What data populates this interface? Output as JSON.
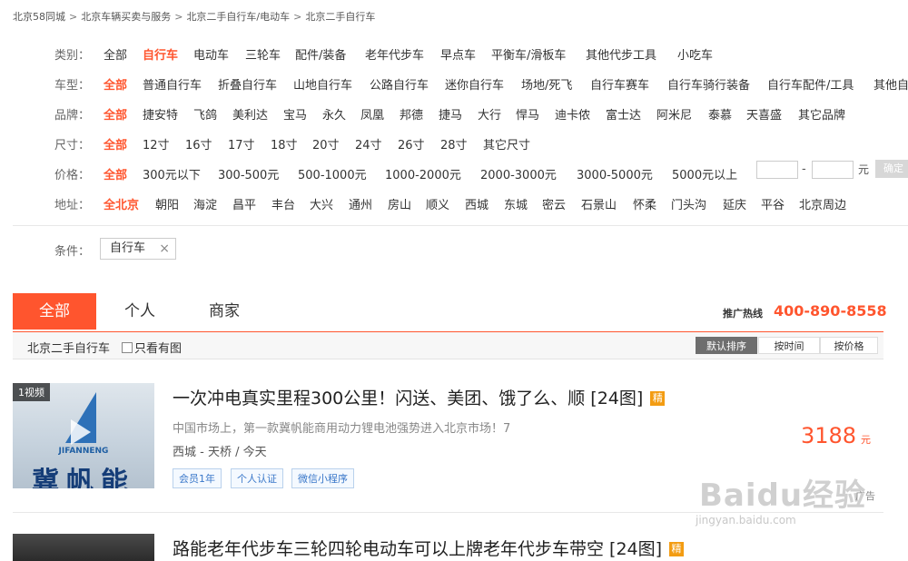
{
  "breadcrumb": [
    "北京58同城",
    "北京车辆买卖与服务",
    "北京二手自行车/电动车",
    "北京二手自行车"
  ],
  "breadcrumb_separator": ">",
  "filters": {
    "category": {
      "label": "类别：",
      "options": [
        "全部",
        "自行车",
        "电动车",
        "三轮车",
        "配件/装备",
        "老年代步车",
        "早点车",
        "平衡车/滑板车",
        "其他代步工具",
        "小吃车"
      ]
    },
    "type": {
      "label": "车型：",
      "options": [
        "全部",
        "普通自行车",
        "折叠自行车",
        "山地自行车",
        "公路自行车",
        "迷你自行车",
        "场地/死飞",
        "自行车赛车",
        "自行车骑行装备",
        "自行车配件/工具",
        "其他自"
      ]
    },
    "brand": {
      "label": "品牌：",
      "options": [
        "全部",
        "捷安特",
        "飞鸽",
        "美利达",
        "宝马",
        "永久",
        "凤凰",
        "邦德",
        "捷马",
        "大行",
        "悍马",
        "迪卡侬",
        "富士达",
        "阿米尼",
        "泰慕",
        "天喜盛",
        "其它品牌"
      ]
    },
    "size": {
      "label": "尺寸：",
      "options": [
        "全部",
        "12寸",
        "16寸",
        "17寸",
        "18寸",
        "20寸",
        "24寸",
        "26寸",
        "28寸",
        "其它尺寸"
      ]
    },
    "price": {
      "label": "价格：",
      "options": [
        "全部",
        "300元以下",
        "300-500元",
        "500-1000元",
        "1000-2000元",
        "2000-3000元",
        "3000-5000元",
        "5000元以上"
      ],
      "dash": "-",
      "unit": "元",
      "confirm": "确定"
    },
    "district": {
      "label": "地址：",
      "options": [
        "全北京",
        "朝阳",
        "海淀",
        "昌平",
        "丰台",
        "大兴",
        "通州",
        "房山",
        "顺义",
        "西城",
        "东城",
        "密云",
        "石景山",
        "怀柔",
        "门头沟",
        "延庆",
        "平谷",
        "北京周边"
      ]
    }
  },
  "condition": {
    "label": "条件：",
    "tag": "自行车",
    "remove": "×"
  },
  "tabs": {
    "all": "全部",
    "personal": "个人",
    "merchant": "商家"
  },
  "hotline": {
    "label": "推广热线",
    "number": "400-890-8558"
  },
  "subbar": {
    "title": "北京二手自行车",
    "checkbox_label": "只看有图",
    "sort_default": "默认排序",
    "sort_time": "按时间",
    "sort_price": "按价格"
  },
  "listings": [
    {
      "video_badge": "1视频",
      "thumb_text": "JIFANNENG",
      "thumb_brand": "冀帆能",
      "title": "一次冲电真实里程300公里！闪送、美团、饿了么、顺 [24图]",
      "badge": "精",
      "desc": "中国市场上，第一款冀帆能商用动力锂电池强势进入北京市场！7",
      "location": "西城 - 天桥  / 今天",
      "tags": [
        "会员1年",
        "个人认证",
        "微信小程序"
      ],
      "price": "3188",
      "price_unit": "元",
      "ad": "广告"
    },
    {
      "title": "路能老年代步车三轮四轮电动车可以上牌老年代步车带空 [24图]",
      "badge": "精"
    }
  ],
  "watermark": {
    "main": "Baidu经验",
    "sub": "jingyan.baidu.com"
  },
  "colors": {
    "accent": "#ff552e",
    "tag_blue": "#3a78c9",
    "jing_badge": "#f39c12"
  }
}
